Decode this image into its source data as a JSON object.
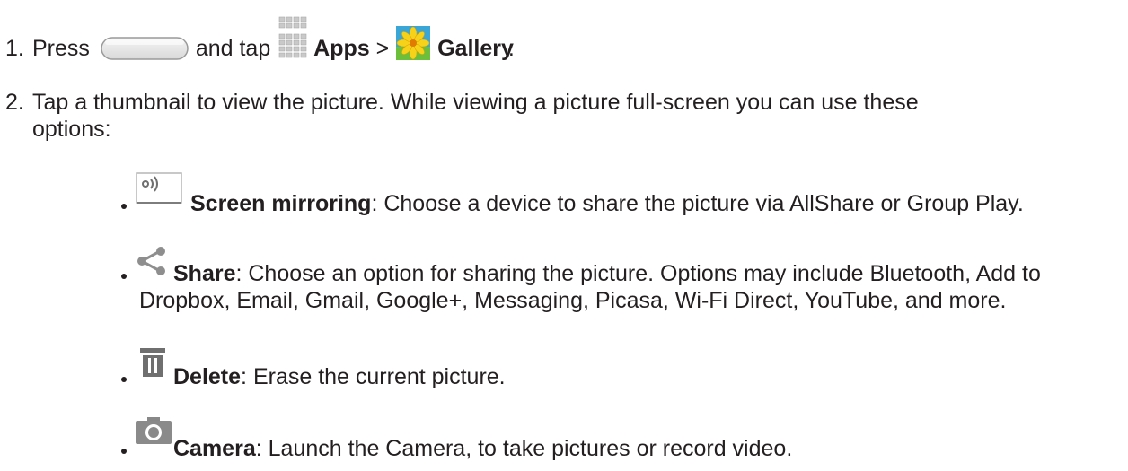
{
  "step1": {
    "number": "1.",
    "press": "Press",
    "and_tap": "and tap",
    "apps": "Apps",
    "separator": ">",
    "gallery": "Gallery",
    "period": ".",
    "icons": [
      "home-key-icon",
      "apps-grid-icon",
      "gallery-icon"
    ]
  },
  "step2": {
    "number": "2.",
    "line1": "Tap a thumbnail to view the picture. While viewing a picture full-screen you can use these",
    "line2": "options:"
  },
  "options": [
    {
      "icon": "screen-mirroring-icon",
      "title": "Screen mirroring",
      "description": ": Choose a device to share the picture via AllShare or Group Play."
    },
    {
      "icon": "share-icon",
      "title": "Share",
      "description": ": Choose an option for sharing the picture. Options may include Bluetooth, Add to",
      "description_line2": "Dropbox, Email, Gmail, Google+, Messaging, Picasa, Wi-Fi Direct, YouTube, and more."
    },
    {
      "icon": "trash-icon",
      "title": "Delete",
      "description": ": Erase the current picture."
    },
    {
      "icon": "camera-icon",
      "title": "Camera",
      "description": ": Launch the Camera, to take pictures or record video."
    }
  ]
}
